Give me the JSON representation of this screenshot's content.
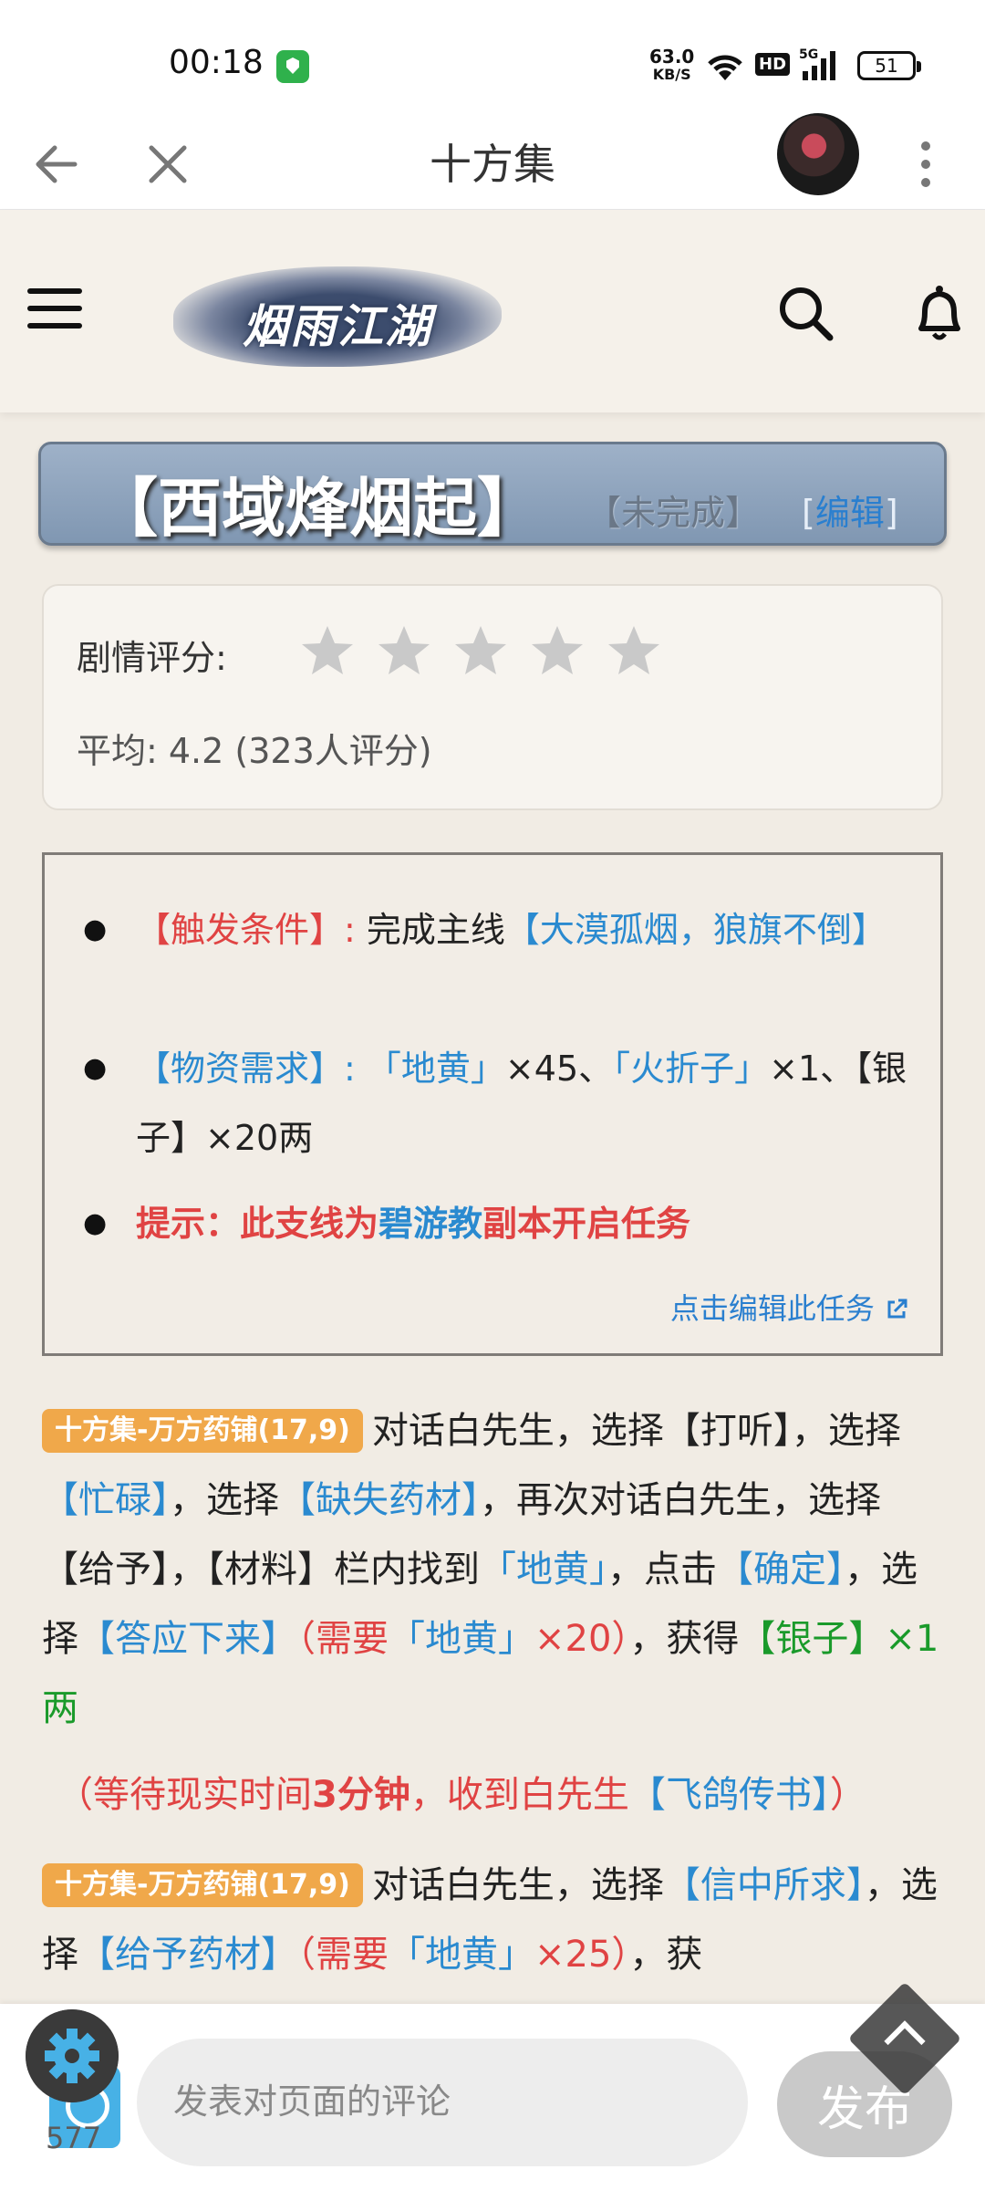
{
  "status": {
    "time": "00:18",
    "speed_value": "63.0",
    "speed_unit": "KB/S",
    "hd": "HD",
    "network": "5G",
    "battery": "51"
  },
  "nav": {
    "title": "十方集"
  },
  "header": {
    "logo_text": "烟雨江湖"
  },
  "quest": {
    "title": "【西域烽烟起】",
    "status": "【未完成】",
    "edit_prefix": "[",
    "edit_label": "编辑",
    "edit_suffix": "]"
  },
  "rating": {
    "label": "剧情评分:",
    "stars": 5,
    "average": "平均: 4.2 (323人评分)"
  },
  "info": {
    "trigger_label": "【触发条件】:",
    "trigger_text": "完成主线",
    "trigger_link": "【大漠孤烟，狼旗不倒】",
    "material_label": "【物资需求】:",
    "material_item1": "「地黄」",
    "material_qty1": "×45、",
    "material_item2": "「火折子」",
    "material_qty2": "×1、【银子】×20两",
    "tip_prefix": "提示：此支线为",
    "tip_link": "碧游教",
    "tip_suffix": "副本开启任务",
    "edit_task": "点击编辑此任务"
  },
  "steps": {
    "step1_tag": "十方集-万方药铺(17,9)",
    "step1_a": "对话白先生，选择【打听】，选择",
    "step1_b": "【忙碌】",
    "step1_c": "，选择",
    "step1_d": "【缺失药材】",
    "step1_e": "，再次对话白先生，选择【给予】，【材料】栏内找到",
    "step1_f": "「地黄」",
    "step1_g": "，点击",
    "step1_h": "【确定】",
    "step1_i": "，选择",
    "step1_j": "【答应下来】",
    "step1_k": "（需要",
    "step1_l": "「地黄」",
    "step1_m": "×20）",
    "step1_n": "，获得",
    "step1_o": "【银子】×1两",
    "note_a": "（等待现实时间",
    "note_b": "3分钟",
    "note_c": "，收到白先生",
    "note_d": "【飞鸽传书】",
    "note_e": "）",
    "step2_tag": "十方集-万方药铺(17,9)",
    "step2_a": "对话白先生，选择",
    "step2_b": "【信中所求】",
    "step2_c": "，选择",
    "step2_d": "【给予药材】",
    "step2_e": "（需要",
    "step2_f": "「地黄」",
    "step2_g": "×25）",
    "step2_h": "，获"
  },
  "comment": {
    "placeholder": "发表对页面的评论",
    "count": "577",
    "send_label": "发布"
  },
  "colors": {
    "accent_red": "#e04343",
    "link_blue": "#2a8ad0",
    "tag_orange": "#f0a84a",
    "reward_green": "#1a9a2a"
  }
}
